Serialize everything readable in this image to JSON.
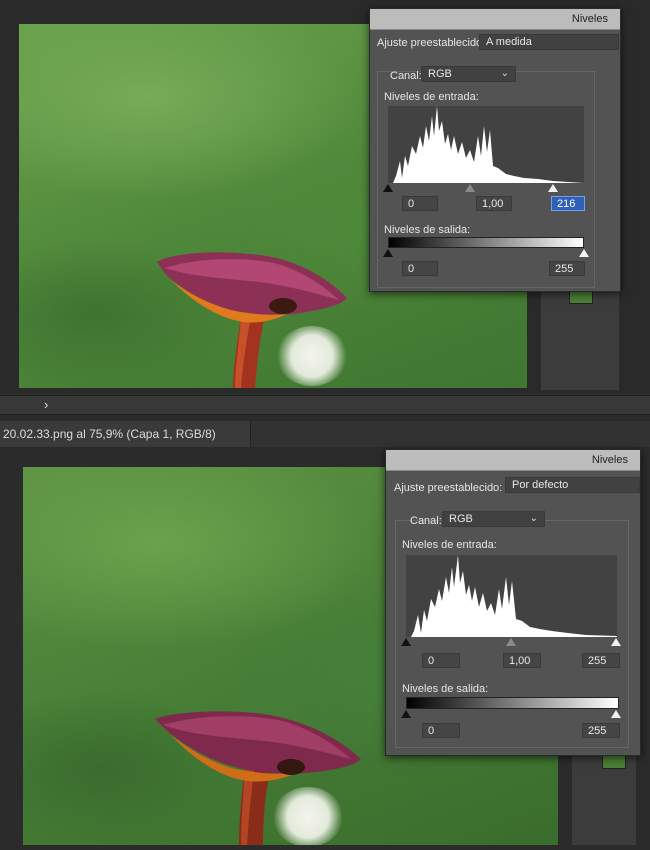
{
  "top": {
    "dialog": {
      "title": "Niveles",
      "preset_label": "Ajuste preestablecido:",
      "preset_value": "A medida",
      "channel_label": "Canal:",
      "channel_value": "RGB",
      "input_label": "Niveles de entrada:",
      "input_values": [
        "0",
        "1,00",
        "216"
      ],
      "output_label": "Niveles de salida:",
      "output_values": [
        "0",
        "255"
      ]
    }
  },
  "tabbar": {
    "arrow": "›"
  },
  "status": {
    "text": "20.02.33.png al 75,9% (Capa 1, RGB/8)"
  },
  "bottom": {
    "dialog": {
      "title": "Niveles",
      "preset_label": "Ajuste preestablecido:",
      "preset_value": "Por defecto",
      "channel_label": "Canal:",
      "channel_value": "RGB",
      "input_label": "Niveles de entrada:",
      "input_values": [
        "0",
        "1,00",
        "255"
      ],
      "output_label": "Niveles de salida:",
      "output_values": [
        "0",
        "255"
      ]
    }
  },
  "icons": {
    "chevron": "chevron-down-icon",
    "arrow": "chevron-right-icon"
  }
}
